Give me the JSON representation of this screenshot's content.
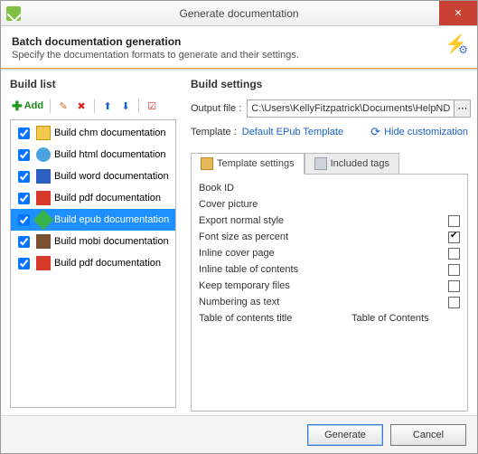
{
  "window": {
    "title": "Generate documentation"
  },
  "header": {
    "title": "Batch documentation generation",
    "subtitle": "Specify the documentation formats to generate and their settings."
  },
  "left": {
    "title": "Build list",
    "add_label": "Add",
    "items": [
      {
        "label": "Build chm documentation",
        "icon": "chm",
        "checked": true,
        "selected": false
      },
      {
        "label": "Build html documentation",
        "icon": "html",
        "checked": true,
        "selected": false
      },
      {
        "label": "Build word documentation",
        "icon": "word",
        "checked": true,
        "selected": false
      },
      {
        "label": "Build pdf documentation",
        "icon": "pdf",
        "checked": true,
        "selected": false
      },
      {
        "label": "Build epub documentation",
        "icon": "epub",
        "checked": true,
        "selected": true
      },
      {
        "label": "Build mobi documentation",
        "icon": "mobi",
        "checked": true,
        "selected": false
      },
      {
        "label": "Build pdf documentation",
        "icon": "pdf",
        "checked": true,
        "selected": false
      }
    ]
  },
  "right": {
    "title": "Build settings",
    "output_label": "Output file :",
    "output_value": "C:\\Users\\KellyFitzpatrick\\Documents\\HelpND",
    "template_label": "Template :",
    "template_value": "Default EPub Template",
    "hide_custom": "Hide customization",
    "tabs": [
      {
        "label": "Template settings",
        "icon": "ti-template",
        "active": true
      },
      {
        "label": "Included tags",
        "icon": "ti-tag",
        "active": false
      }
    ],
    "settings": [
      {
        "label": "Book ID",
        "type": "blank"
      },
      {
        "label": "Cover picture",
        "type": "blank"
      },
      {
        "label": "Export normal style",
        "type": "check",
        "checked": false
      },
      {
        "label": "Font size as percent",
        "type": "check",
        "checked": true
      },
      {
        "label": "Inline cover page",
        "type": "check",
        "checked": false
      },
      {
        "label": "Inline table of contents",
        "type": "check",
        "checked": false
      },
      {
        "label": "Keep temporary files",
        "type": "check",
        "checked": false
      },
      {
        "label": "Numbering as text",
        "type": "check",
        "checked": false
      },
      {
        "label": "Table of contents title",
        "type": "text",
        "value": "Table of Contents"
      }
    ]
  },
  "footer": {
    "generate": "Generate",
    "cancel": "Cancel"
  }
}
